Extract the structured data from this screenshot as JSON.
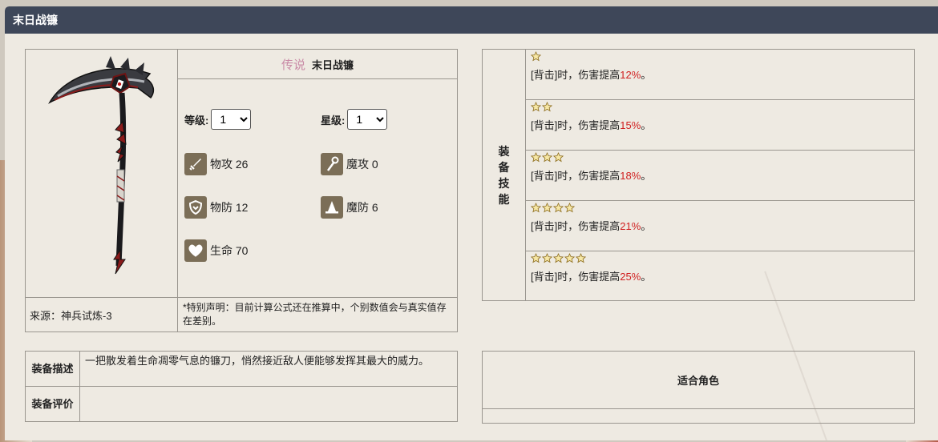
{
  "header": {
    "title": "末日战镰"
  },
  "weapon": {
    "rarity": "传说",
    "name": "末日战镰",
    "level_label": "等级:",
    "level_value": "1",
    "star_label": "星级:",
    "star_value": "1",
    "stats": [
      {
        "icon": "sword-icon",
        "text": "物攻 26"
      },
      {
        "icon": "magic-staff-icon",
        "text": "魔攻 0"
      },
      {
        "icon": "shield-icon",
        "text": "物防 12"
      },
      {
        "icon": "wizard-hat-icon",
        "text": "魔防 6"
      },
      {
        "icon": "heart-icon",
        "text": "生命 70"
      }
    ],
    "source": "来源：神兵试炼-3",
    "note": "*特别声明：目前计算公式还在推算中，个别数值会与真实值存在差别。"
  },
  "skills": {
    "label": "装\n备\n技\n能",
    "rows": [
      {
        "stars": 1,
        "prefix": "[背击]时，伤害提高",
        "value": "12%",
        "suffix": "。"
      },
      {
        "stars": 2,
        "prefix": "[背击]时，伤害提高",
        "value": "15%",
        "suffix": "。"
      },
      {
        "stars": 3,
        "prefix": "[背击]时，伤害提高",
        "value": "18%",
        "suffix": "。"
      },
      {
        "stars": 4,
        "prefix": "[背击]时，伤害提高",
        "value": "21%",
        "suffix": "。"
      },
      {
        "stars": 5,
        "prefix": "[背击]时，伤害提高",
        "value": "25%",
        "suffix": "。"
      }
    ]
  },
  "description": {
    "label": "装备描述",
    "text": "一把散发着生命凋零气息的镰刀，悄然接近敌人便能够发挥其最大的威力。",
    "rating_label": "装备评价",
    "rating_text": ""
  },
  "roles": {
    "title": "适合角色"
  },
  "colors": {
    "header_bg": "#3e4759",
    "percent": "#d01f1f",
    "rarity": "#c98aa6",
    "icon_bg": "#7b6e57"
  }
}
